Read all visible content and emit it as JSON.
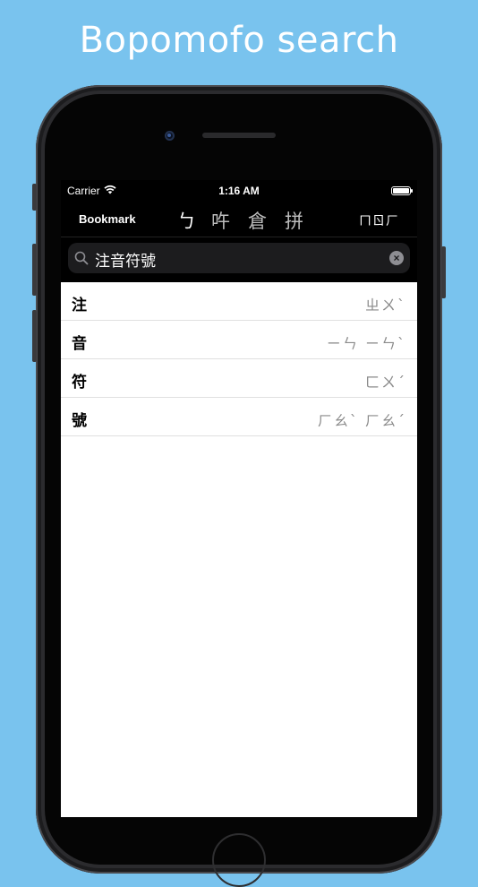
{
  "headline": "Bopomofo search",
  "status_bar": {
    "carrier": "Carrier",
    "time": "1:16 AM"
  },
  "navbar": {
    "bookmark_label": "Bookmark",
    "segments": [
      "ㄅ",
      "吘",
      "倉",
      "拼"
    ],
    "active_segment": 0,
    "right_label": "ㄇㄖㄏ"
  },
  "search": {
    "value": "注音符號",
    "icon": "search-icon"
  },
  "results": [
    {
      "char": "注",
      "zhuyin": "ㄓㄨˋ"
    },
    {
      "char": "音",
      "zhuyin": "ㄧㄣ ㄧㄣˋ"
    },
    {
      "char": "符",
      "zhuyin": "ㄈㄨˊ"
    },
    {
      "char": "號",
      "zhuyin": "ㄏㄠˋ ㄏㄠˊ"
    }
  ],
  "colors": {
    "background": "#79c3ee",
    "screen_dark": "#000000",
    "list_bg": "#ffffff",
    "secondary_text": "#8a8a8a"
  }
}
